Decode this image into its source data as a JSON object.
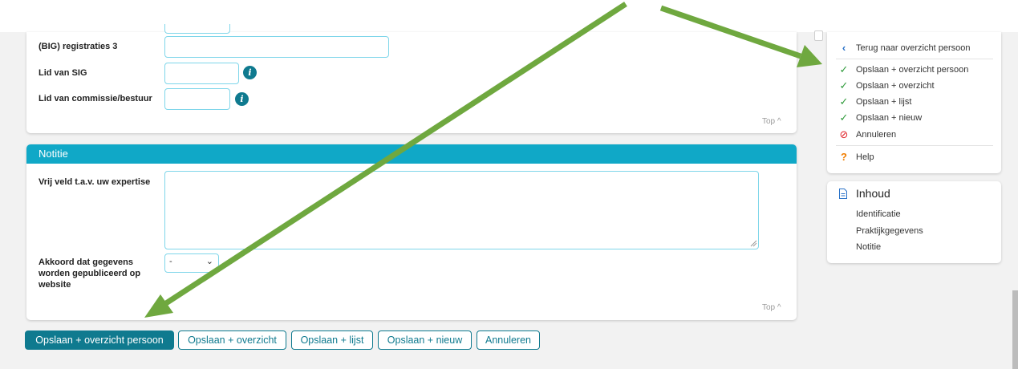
{
  "form": {
    "big3_label": "(BIG) registraties 3",
    "sig_label": "Lid van SIG",
    "commissie_label": "Lid van commissie/bestuur",
    "top_label": "Top",
    "notitie": {
      "header": "Notitie",
      "expertise_label": "Vrij veld t.a.v. uw expertise",
      "akkoord_label": "Akkoord dat gegevens worden gepubliceerd op website",
      "akkoord_value": "-",
      "top_label": "Top"
    }
  },
  "actions": {
    "save_person": "Opslaan + overzicht persoon",
    "save_overview": "Opslaan + overzicht",
    "save_list": "Opslaan + lijst",
    "save_new": "Opslaan + nieuw",
    "cancel": "Annuleren"
  },
  "sidebar": {
    "back": "Terug naar overzicht persoon",
    "items": [
      {
        "label": "Opslaan + overzicht persoon",
        "icon": "check-icon"
      },
      {
        "label": "Opslaan + overzicht",
        "icon": "check-icon"
      },
      {
        "label": "Opslaan + lijst",
        "icon": "check-icon"
      },
      {
        "label": "Opslaan + nieuw",
        "icon": "check-icon"
      },
      {
        "label": "Annuleren",
        "icon": "cancel-icon"
      }
    ],
    "help": "Help"
  },
  "toc": {
    "title": "Inhoud",
    "items": [
      "Identificatie",
      "Praktijkgegevens",
      "Notitie"
    ]
  },
  "colors": {
    "primary": "#0f7a8f",
    "header": "#10a8c7",
    "field_border": "#7fd6ea",
    "arrow": "#6fa83f",
    "check": "#2e9a3a",
    "cancel": "#e0242a",
    "help": "#f07d00"
  }
}
